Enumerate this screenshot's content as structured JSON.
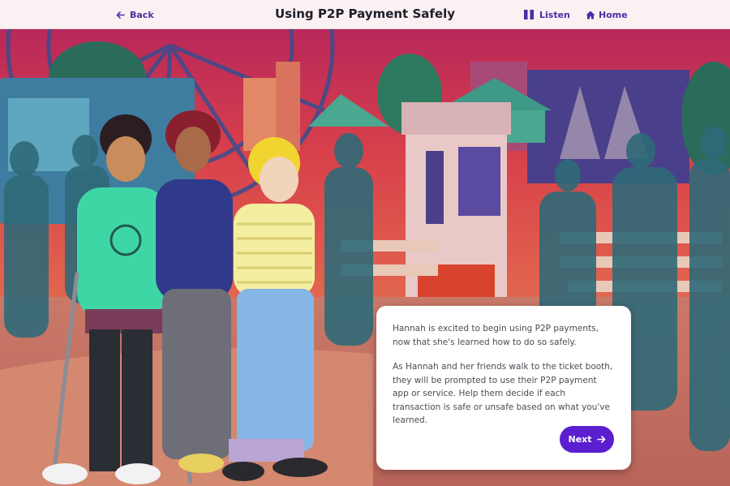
{
  "header": {
    "back_label": "Back",
    "title": "Using P2P Payment Safely",
    "listen_label": "Listen",
    "home_label": "Home"
  },
  "icons": {
    "back": "arrow-left-icon",
    "listen": "pause-icon",
    "home": "home-icon",
    "next": "arrow-right-icon"
  },
  "dialog": {
    "paragraph_1": "Hannah is excited to begin using P2P payments, now that she's learned how to do so safely.",
    "paragraph_2": "As Hannah and her friends walk to the ticket booth, they will be prompted to use their P2P payment app or service. Help them decide if each transaction is safe or unsafe based on what you've learned.",
    "next_label": "Next"
  },
  "colors": {
    "accent": "#5b1fd0",
    "header_bg": "#fbf0f2",
    "sky": "#c8324f",
    "crowd": "#2f6a78"
  }
}
